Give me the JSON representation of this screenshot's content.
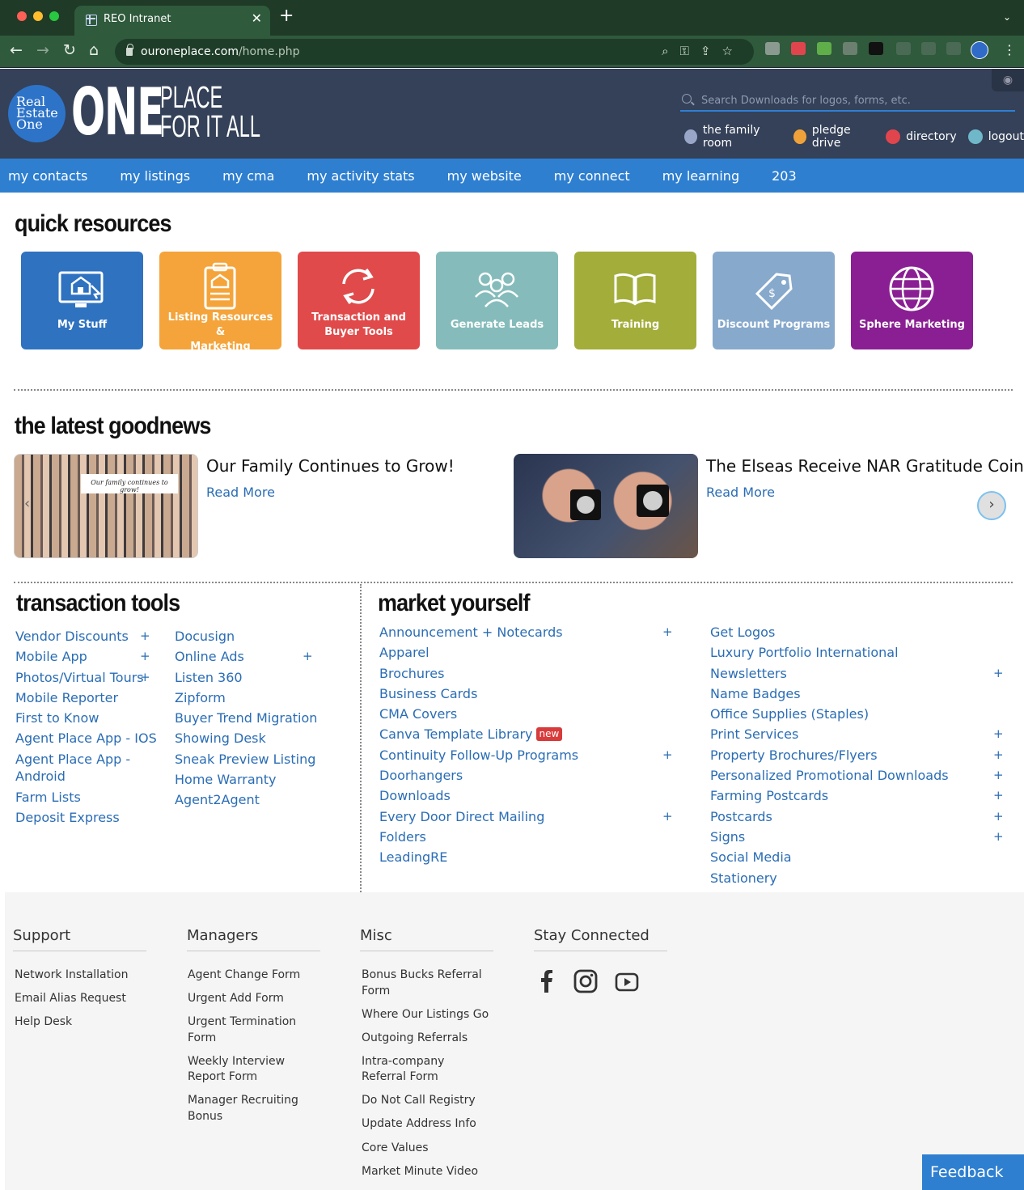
{
  "browser": {
    "tab_title": "REO Intranet",
    "url_host": "ouroneplace.com",
    "url_path": "/home.php"
  },
  "header": {
    "logo_circle_lines": [
      "Real",
      "Estate",
      "One"
    ],
    "logo_big": "ONE",
    "logo_sub_line1": "PLACE",
    "logo_sub_line2": "FOR IT ALL",
    "search_placeholder": "Search Downloads for logos, forms, etc.",
    "util_links": [
      {
        "label": "the family room",
        "color": "#9aa6c8"
      },
      {
        "label": "pledge drive",
        "color": "#f0a23a"
      },
      {
        "label": "directory",
        "color": "#e0454d"
      },
      {
        "label": "logout",
        "color": "#6fb8c9"
      }
    ]
  },
  "nav": [
    "my contacts",
    "my listings",
    "my cma",
    "my activity stats",
    "my website",
    "my connect",
    "my learning",
    "203"
  ],
  "quick_resources": {
    "title": "quick resources",
    "tiles": [
      {
        "label_line1": "",
        "label_line2": "My Stuff",
        "color": "#2e72c0",
        "icon": "computer-home-icon"
      },
      {
        "label_line1": "Listing Resources &",
        "label_line2": "Marketing",
        "color": "#f4a43a",
        "icon": "clipboard-house-icon"
      },
      {
        "label_line1": "Transaction and",
        "label_line2": "Buyer Tools",
        "color": "#e04a4a",
        "icon": "arrows-cycle-icon"
      },
      {
        "label_line1": "",
        "label_line2": "Generate Leads",
        "color": "#85bcbb",
        "icon": "people-group-icon"
      },
      {
        "label_line1": "",
        "label_line2": "Training",
        "color": "#a3ad3a",
        "icon": "book-icon"
      },
      {
        "label_line1": "",
        "label_line2": "Discount Programs",
        "color": "#87a9cc",
        "icon": "price-tag-icon"
      },
      {
        "label_line1": "",
        "label_line2": "Sphere Marketing",
        "color": "#8a1f93",
        "icon": "globe-icon"
      }
    ]
  },
  "news": {
    "title": "the latest goodnews",
    "items": [
      {
        "title": "Our Family Continues to Grow!",
        "read_more": "Read More",
        "image_caption": "Our family continues to grow!"
      },
      {
        "title": "The Elseas Receive NAR Gratitude Coin",
        "read_more": "Read More"
      }
    ]
  },
  "transaction_tools": {
    "title": "transaction tools",
    "col1": [
      "Vendor Discounts",
      "Mobile App",
      "Photos/Virtual Tours",
      "Mobile Reporter",
      "First to Know",
      "Agent Place App - IOS",
      "Agent Place App -",
      "Android",
      "Farm Lists",
      "Deposit Express"
    ],
    "col2": [
      "Docusign",
      "Online Ads",
      "Listen 360",
      "Zipform",
      "Buyer Trend Migration",
      "Showing Desk",
      "Sneak Preview Listing",
      "Home Warranty",
      "Agent2Agent"
    ]
  },
  "market_yourself": {
    "title": "market yourself",
    "col1": [
      "Announcement + Notecards",
      "Apparel",
      "Brochures",
      "Business Cards",
      "CMA Covers",
      "Canva Template Library",
      "Continuity Follow-Up Programs",
      "Doorhangers",
      "Downloads",
      "Every Door Direct Mailing",
      "Folders",
      "LeadingRE"
    ],
    "col2": [
      "Get Logos",
      "Luxury Portfolio International",
      "Newsletters",
      "Name Badges",
      "Office Supplies (Staples)",
      "Print Services",
      "Property Brochures/Flyers",
      "Personalized Promotional Downloads",
      "Farming Postcards",
      "Postcards",
      "Signs",
      "Social Media",
      "Stationery"
    ],
    "new_badge": "new",
    "plus": "+"
  },
  "footer": {
    "support": {
      "title": "Support",
      "items": [
        "Network Installation",
        "Email Alias Request",
        "Help Desk"
      ]
    },
    "managers": {
      "title": "Managers",
      "items": [
        "Agent Change Form",
        "Urgent Add Form",
        "Urgent Termination Form",
        "Weekly Interview Report Form",
        "Manager Recruiting Bonus"
      ]
    },
    "misc": {
      "title": "Misc",
      "items": [
        "Bonus Bucks Referral Form",
        "Where Our Listings Go",
        "Outgoing Referrals",
        "Intra-company Referral Form",
        "Do Not Call Registry",
        "Update Address Info",
        "Core Values",
        "Market Minute Video"
      ]
    },
    "stay_connected": {
      "title": "Stay Connected"
    },
    "feedback": "Feedback"
  }
}
